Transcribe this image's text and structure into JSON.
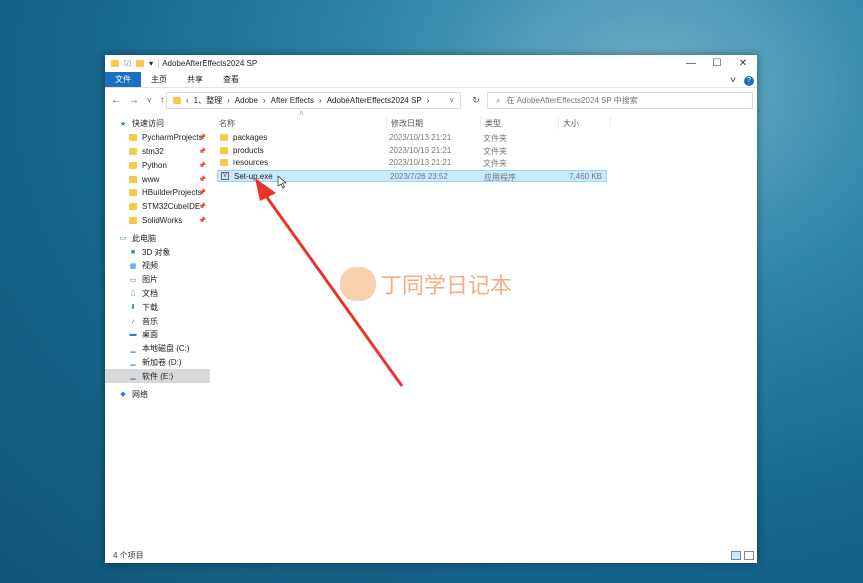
{
  "window": {
    "title": "AdobeAfterEffects2024 SP",
    "controls": [
      "—",
      "☐",
      "✕"
    ]
  },
  "ribbon": {
    "tabs": [
      "文件",
      "主页",
      "共享",
      "查看"
    ],
    "help": "?"
  },
  "nav": {
    "back": "←",
    "forward": "→",
    "recent": "˅",
    "up": "↑"
  },
  "address": {
    "crumbs": [
      "1、整理",
      "Adobe",
      "After Effects",
      "AdobeAfterEffects2024 SP"
    ],
    "refresh": "↻"
  },
  "search": {
    "placeholder": "在 AdobeAfterEffects2024 SP 中搜索"
  },
  "sidebar": {
    "quick_access": "快速访问",
    "pinned": [
      "PycharmProjects",
      "stm32",
      "Python",
      "www",
      "HBuilderProjects",
      "STM32CubeIDE",
      "SolidWorks"
    ],
    "this_pc": "此电脑",
    "pc_items": [
      {
        "label": "3D 对象",
        "icon": "cube-icon"
      },
      {
        "label": "视频",
        "icon": "video-icon"
      },
      {
        "label": "图片",
        "icon": "picture-icon"
      },
      {
        "label": "文档",
        "icon": "document-icon"
      },
      {
        "label": "下载",
        "icon": "download-icon"
      },
      {
        "label": "音乐",
        "icon": "music-icon"
      },
      {
        "label": "桌面",
        "icon": "desktop-icon"
      },
      {
        "label": "本地磁盘 (C:)",
        "icon": "drive-icon"
      },
      {
        "label": "新加卷 (D:)",
        "icon": "drive-icon"
      },
      {
        "label": "软件 (E:)",
        "icon": "drive-icon"
      }
    ],
    "network": "网络"
  },
  "columns": {
    "name": "名称",
    "date": "修改日期",
    "type": "类型",
    "size": "大小"
  },
  "files": [
    {
      "name": "packages",
      "date": "2023/10/13 21:21",
      "type": "文件夹",
      "size": ""
    },
    {
      "name": "products",
      "date": "2023/10/13 21:21",
      "type": "文件夹",
      "size": ""
    },
    {
      "name": "resources",
      "date": "2023/10/13 21:21",
      "type": "文件夹",
      "size": ""
    },
    {
      "name": "Set-up.exe",
      "date": "2023/7/26 23:52",
      "type": "应用程序",
      "size": "7,460 KB"
    }
  ],
  "status": {
    "count": "4 个项目"
  },
  "watermark": "丁同学日记本",
  "colors": {
    "accent": "#1a6fc0",
    "selection": "#cce8ff",
    "arrow": "#e8352a"
  }
}
